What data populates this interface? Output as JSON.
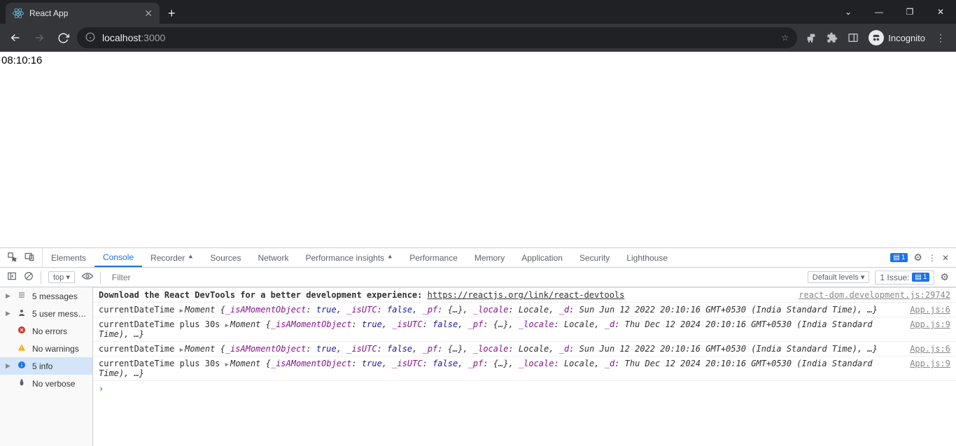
{
  "browser": {
    "tab_title": "React App",
    "url_prefix": "localhost",
    "url_suffix": ":3000",
    "incognito_label": "Incognito"
  },
  "page": {
    "time_display": "08:10:16"
  },
  "devtools": {
    "tabs": [
      "Elements",
      "Console",
      "Recorder",
      "Sources",
      "Network",
      "Performance insights",
      "Performance",
      "Memory",
      "Application",
      "Security",
      "Lighthouse"
    ],
    "active_tab": "Console",
    "issues_badge": "1",
    "subbar": {
      "context": "top",
      "filter_placeholder": "Filter",
      "levels_label": "Default levels",
      "issue_label": "1 Issue:",
      "issue_count": "1"
    },
    "sidebar": [
      {
        "icon": "list",
        "label": "5 messages",
        "expandable": true
      },
      {
        "icon": "user",
        "label": "5 user mess…",
        "expandable": true
      },
      {
        "icon": "error",
        "label": "No errors",
        "expandable": false
      },
      {
        "icon": "warn",
        "label": "No warnings",
        "expandable": false
      },
      {
        "icon": "info",
        "label": "5 info",
        "expandable": true,
        "selected": true
      },
      {
        "icon": "bug",
        "label": "No verbose",
        "expandable": false
      }
    ],
    "console": {
      "first_line_prefix": "Download the React DevTools for a better development experience: ",
      "first_line_link": "https://reactjs.org/link/react-devtools",
      "first_line_src": "react-dom.development.js:29742",
      "rows": [
        {
          "label": "currentDateTime",
          "date": "Sun Jun 12 2022 20:10:16 GMT+0530 (India Standard Time)",
          "src": "App.js:6"
        },
        {
          "label": "currentDateTime plus 30s",
          "date": "Thu Dec 12 2024 20:10:16 GMT+0530 (India Standard Time)",
          "src": "App.js:9"
        },
        {
          "label": "currentDateTime",
          "date": "Sun Jun 12 2022 20:10:16 GMT+0530 (India Standard Time)",
          "src": "App.js:6"
        },
        {
          "label": "currentDateTime plus 30s",
          "date": "Thu Dec 12 2024 20:10:16 GMT+0530 (India Standard Time)",
          "src": "App.js:9"
        }
      ]
    }
  }
}
